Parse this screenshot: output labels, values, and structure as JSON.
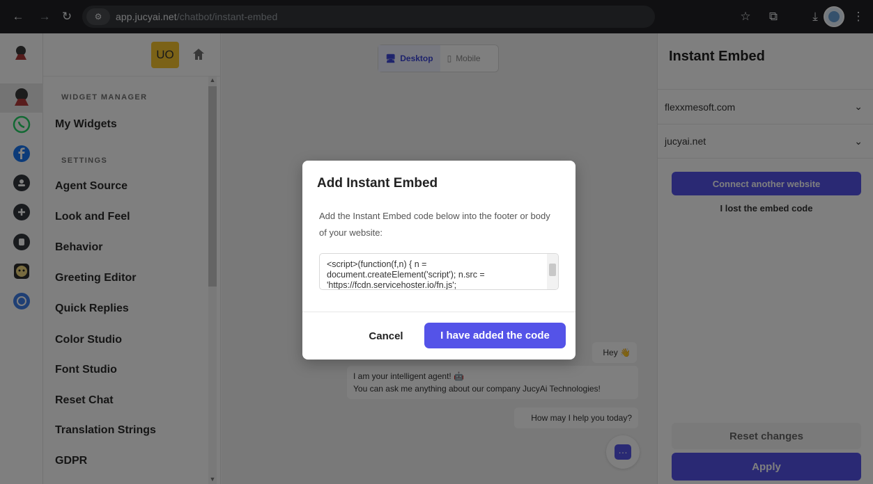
{
  "browser": {
    "back_icon": "arrow-left-icon",
    "forward_icon": "arrow-right-icon",
    "reload_icon": "reload-icon",
    "url_domain": "app.jucyai.net",
    "url_path": "/chatbot/instant-embed"
  },
  "header": {
    "user_initials": "UO"
  },
  "sidebar": {
    "section_widget": "WIDGET MANAGER",
    "my_widgets": "My Widgets",
    "section_settings": "SETTINGS",
    "items": [
      "Agent Source",
      "Look and Feel",
      "Behavior",
      "Greeting Editor",
      "Quick Replies",
      "Color Studio",
      "Font Studio",
      "Reset Chat",
      "Translation Strings",
      "GDPR"
    ]
  },
  "preview": {
    "desktop_label": "Desktop",
    "mobile_label": "Mobile",
    "messages": {
      "hey": "Hey 👋",
      "intro_line1": "I am your intelligent agent! 🤖",
      "intro_line2": "You can ask me anything about our company JucyAi Technologies!",
      "help": "How may I help you today?"
    }
  },
  "panel": {
    "title": "Instant Embed",
    "sites": [
      "flexxmesoft.com",
      "jucyai.net"
    ],
    "connect_label": "Connect another website",
    "lost_label": "I lost the embed code",
    "reset_label": "Reset changes",
    "apply_label": "Apply"
  },
  "modal": {
    "title": "Add Instant Embed",
    "description": "Add the Instant Embed code below into the footer or body of your website:",
    "code": "<script>(function(f,n) { n = document.createElement('script'); n.src = 'https://fcdn.servicehoster.io/fn.js';",
    "cancel_label": "Cancel",
    "confirm_label": "I have added the code"
  },
  "colors": {
    "brand": "#5453e8",
    "avatar_yellow": "#f6c52f"
  }
}
